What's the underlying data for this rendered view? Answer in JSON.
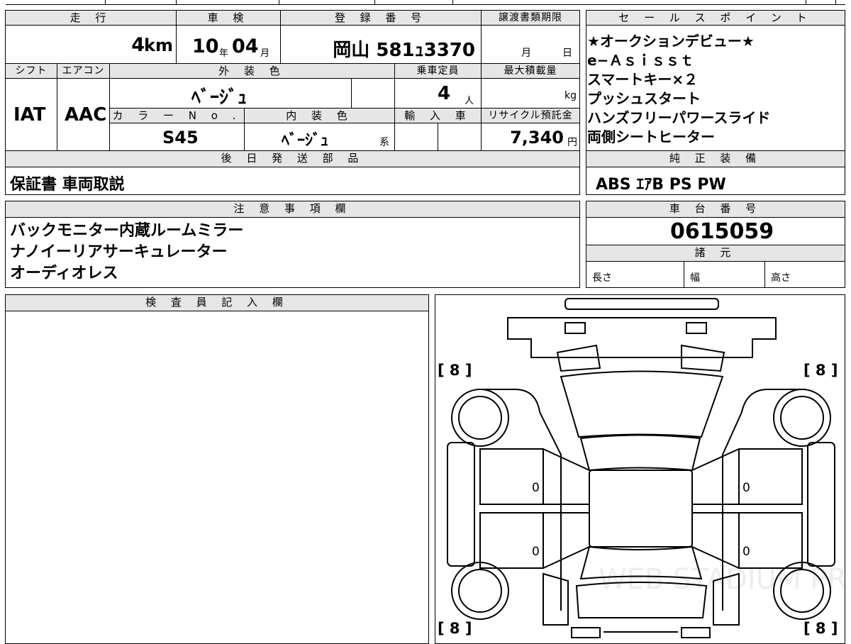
{
  "top": {
    "mileage": {
      "label": "走 行",
      "value": "4",
      "unit": "km"
    },
    "inspection": {
      "label": "車 検",
      "year": "10",
      "year_unit": "年",
      "month": "04",
      "month_unit": "月"
    },
    "registration": {
      "label": "登 録 番 号",
      "value": "岡山 581ｭ3370"
    },
    "transfer_deadline": {
      "label": "譲渡書類期限",
      "month_unit": "月",
      "day_unit": "日"
    }
  },
  "row2": {
    "shift": {
      "label": "シフト",
      "value": "IAT"
    },
    "aircon": {
      "label": "エアコン",
      "value": "AAC"
    },
    "exterior_color": {
      "label": "外 装 色",
      "value": "ﾍﾞｰｼﾞｭ"
    },
    "capacity": {
      "label": "乗車定員",
      "value": "4",
      "unit": "人"
    },
    "max_load": {
      "label": "最大積載量",
      "unit": "kg"
    },
    "color_no": {
      "label": "カ ラ ー N o .",
      "value": "S45"
    },
    "interior_color": {
      "label": "内 装 色",
      "value": "ﾍﾞｰｼﾞｭ",
      "suffix": "系"
    },
    "import": {
      "label": "輸 入 車"
    },
    "recycle": {
      "label": "リサイクル預託金",
      "value": "7,340",
      "unit": "円"
    }
  },
  "later_parts": {
    "label": "後 日 発 送 部 品",
    "value": "保証書 車両取説"
  },
  "sales_points": {
    "label": "セ ー ル ス ポ イ ン ト",
    "lines": [
      "★オークションデビュー★",
      "e−Ａｓｉｓｓｔ",
      "スマートキー×２",
      "プッシュスタート",
      "ハンズフリーパワースライド",
      "両側シートヒーター"
    ]
  },
  "standard_equipment": {
    "label": "純 正 装 備",
    "value": "ABS ｴｱB PS PW"
  },
  "notes": {
    "label": "注 意 事 項 欄",
    "lines": [
      "バックモニター内蔵ルームミラー",
      "ナノイーリアサーキュレーター",
      "オーディオレス"
    ]
  },
  "chassis": {
    "label": "車 台 番 号",
    "value": "0615059"
  },
  "specs": {
    "label": "諸 元",
    "length": "長さ",
    "width": "幅",
    "height": "高さ"
  },
  "inspector": {
    "label": "検 査 員 記 入 欄"
  },
  "diagram": {
    "tire_tl": "[ 8 ]",
    "tire_tr": "[ 8 ]",
    "tire_bl": "[ 8 ]",
    "tire_br": "[ 8 ]",
    "door_l1": "0",
    "door_l2": "0",
    "door_r1": "0",
    "door_r2": "0",
    "watermark": "WEB STADIUM PRO"
  }
}
